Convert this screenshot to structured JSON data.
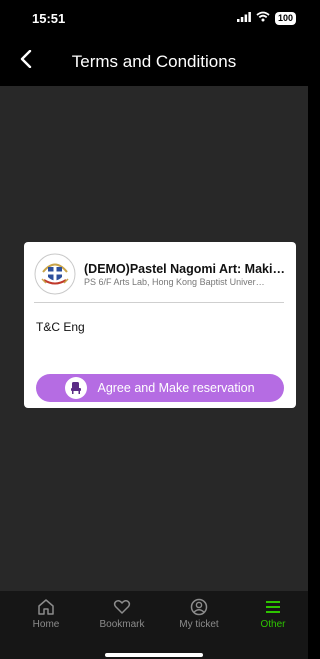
{
  "status": {
    "time": "15:51",
    "battery": "100"
  },
  "nav": {
    "title": "Terms and Conditions",
    "back_icon": "chevron-left-icon"
  },
  "card": {
    "event_title": "(DEMO)Pastel Nagomi Art: Makin…",
    "event_venue": "PS 6/F Arts Lab, Hong Kong Baptist Univer…",
    "terms_text": "T&C Eng",
    "agree_label": "Agree and Make reservation",
    "agree_icon": "seat-icon",
    "accent_color": "#b56ce3"
  },
  "tabs": [
    {
      "label": "Home",
      "icon": "home-icon"
    },
    {
      "label": "Bookmark",
      "icon": "heart-icon"
    },
    {
      "label": "My ticket",
      "icon": "user-icon"
    },
    {
      "label": "Other",
      "icon": "menu-icon",
      "active": true
    }
  ],
  "colors": {
    "active_tab": "#2ec400",
    "content_bg": "#282828"
  }
}
